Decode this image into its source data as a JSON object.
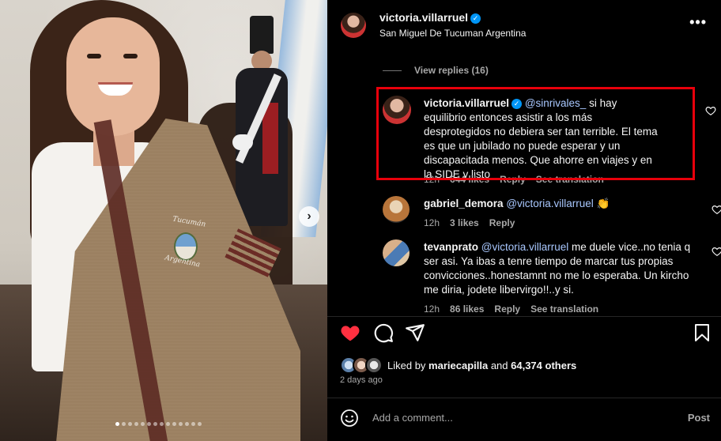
{
  "header": {
    "username": "victoria.villarruel",
    "location": "San Miguel De Tucuman Argentina",
    "more_label": "•••"
  },
  "photo": {
    "emblem_top": "Tucumán",
    "emblem_bottom": "Argentina",
    "next_arrow": "›",
    "carousel_total": 14,
    "carousel_active": 1
  },
  "replies": {
    "view_replies": "View replies (16)"
  },
  "comments": [
    {
      "username": "victoria.villarruel",
      "verified": true,
      "mention": "@sinrivales_",
      "text": " si hay equilibrio entonces asistir a los más desprotegidos no debiera ser tan terrible. El tema es que un jubilado no puede esperar y un discapacitada menos. Que ahorre en viajes y en la SIDE y listo",
      "age": "12h",
      "likes": "644 likes",
      "reply": "Reply",
      "translate": "See translation"
    },
    {
      "username": "gabriel_demora",
      "mention": "@victoria.villarruel",
      "text": " 👏",
      "age": "12h",
      "likes": "3 likes",
      "reply": "Reply"
    },
    {
      "username": "tevanprato",
      "mention": "@victoria.villarruel",
      "text": " me duele vice..no tenia q ser asi. Ya ibas a tenre tiempo de marcar tus propias convicciones..honestamnt no me lo esperaba. Un kircho me diria, jodete libervirgo!!..y si.",
      "age": "12h",
      "likes": "86 likes",
      "reply": "Reply",
      "translate": "See translation"
    }
  ],
  "likes": {
    "prefix": "Liked by ",
    "user": "mariecapilla",
    "middle": " and ",
    "count": "64,374 others"
  },
  "date": "2 days ago",
  "add_comment": {
    "placeholder": "Add a comment...",
    "post": "Post"
  },
  "colors": {
    "background": "#000000",
    "highlight": "#e8000b",
    "heart": "#ff3040",
    "verified": "#0095f6",
    "muted": "#a8a8a8"
  }
}
